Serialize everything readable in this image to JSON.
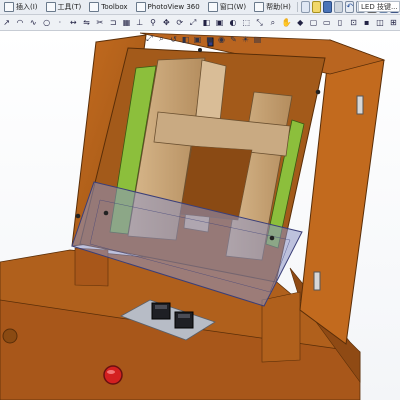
{
  "menu": {
    "items": [
      {
        "label": "插入(I)",
        "icon": "insert-icon"
      },
      {
        "label": "工具(T)",
        "icon": "tools-icon"
      },
      {
        "label": "Toolbox",
        "icon": "toolbox-icon"
      },
      {
        "label": "PhotoView 360",
        "icon": "photoview-icon"
      },
      {
        "label": "窗口(W)",
        "icon": "window-icon"
      },
      {
        "label": "帮助(H)",
        "icon": "help-icon"
      }
    ],
    "search_text": "LED 技键..."
  },
  "scene": {
    "part_colors": {
      "cabinet": "#b5621b",
      "cabinet_dark": "#8a4a12",
      "frame": "#c8a57a",
      "rail_green": "#8cbf3c",
      "panel_blue": "#8d93c4",
      "red_button": "#d42020"
    }
  }
}
